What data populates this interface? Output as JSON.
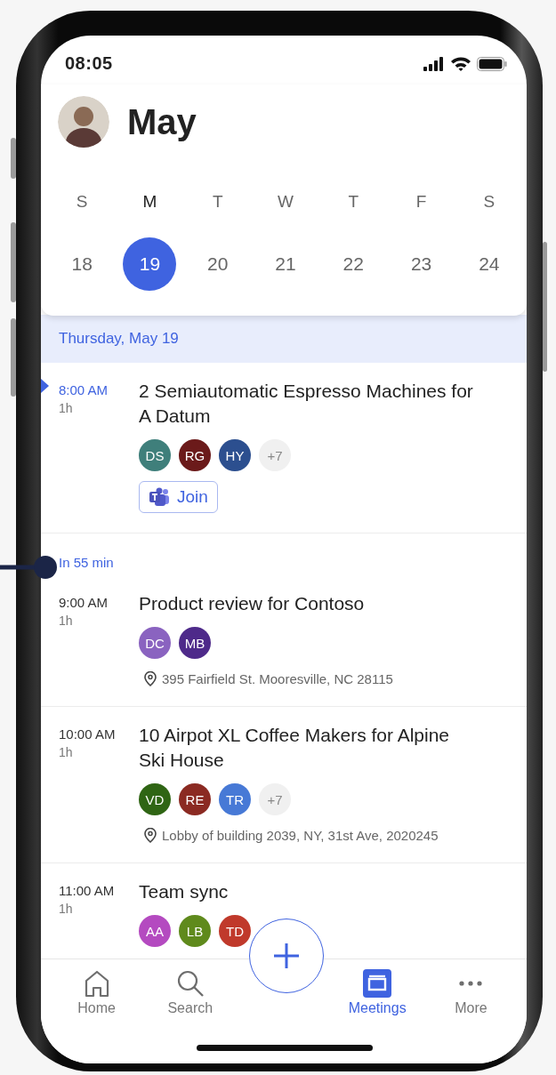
{
  "status_bar": {
    "time": "08:05"
  },
  "header": {
    "title": "May"
  },
  "week": [
    {
      "letter": "S",
      "date": "18",
      "selected": false
    },
    {
      "letter": "M",
      "date": "19",
      "selected": true
    },
    {
      "letter": "T",
      "date": "20",
      "selected": false
    },
    {
      "letter": "W",
      "date": "21",
      "selected": false
    },
    {
      "letter": "T",
      "date": "22",
      "selected": false
    },
    {
      "letter": "F",
      "date": "23",
      "selected": false
    },
    {
      "letter": "S",
      "date": "24",
      "selected": false
    }
  ],
  "date_heading": "Thursday, May 19",
  "events": [
    {
      "current": true,
      "time": "8:00 AM",
      "duration": "1h",
      "title": "2 Semiautomatic Espresso Machines for A Datum",
      "attendees": [
        {
          "initials": "DS",
          "color": "#3f7f7b"
        },
        {
          "initials": "RG",
          "color": "#6b1a1a"
        },
        {
          "initials": "HY",
          "color": "#2c4f8f"
        }
      ],
      "more_count": "+7",
      "join_label": "Join"
    },
    {
      "current": false,
      "countdown": "In 55 min",
      "time": "9:00 AM",
      "duration": "1h",
      "title": "Product review for Contoso",
      "attendees": [
        {
          "initials": "DC",
          "color": "#8a63c0"
        },
        {
          "initials": "MB",
          "color": "#4e2a8a"
        }
      ],
      "location": "395 Fairfield St. Mooresville, NC 28115"
    },
    {
      "current": false,
      "time": "10:00 AM",
      "duration": "1h",
      "title": "10 Airpot XL Coffee Makers for Alpine Ski House",
      "attendees": [
        {
          "initials": "VD",
          "color": "#2f6514"
        },
        {
          "initials": "RE",
          "color": "#8b2a22"
        },
        {
          "initials": "TR",
          "color": "#4779d6"
        }
      ],
      "more_count": "+7",
      "location": "Lobby of building 2039, NY, 31st Ave, 2020245"
    },
    {
      "current": false,
      "time": "11:00 AM",
      "duration": "1h",
      "title": "Team sync",
      "attendees": [
        {
          "initials": "AA",
          "color": "#b44ac0"
        },
        {
          "initials": "LB",
          "color": "#5f8a1c"
        },
        {
          "initials": "TD",
          "color": "#c0392b"
        }
      ]
    }
  ],
  "tabs": [
    {
      "kind": "home",
      "label": "Home",
      "selected": false
    },
    {
      "kind": "search",
      "label": "Search",
      "selected": false
    },
    {
      "kind": "meetings",
      "label": "Meetings",
      "selected": true
    },
    {
      "kind": "more",
      "label": "More",
      "selected": false
    }
  ]
}
